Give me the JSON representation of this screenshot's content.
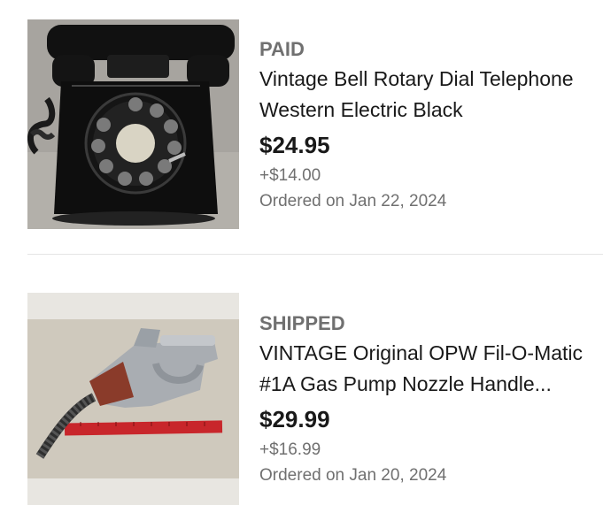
{
  "orders": [
    {
      "status": "PAID",
      "title_line1": "Vintage Bell Rotary Dial Telephone",
      "title_line2": "Western Electric Black",
      "price": "$24.95",
      "shipping": "+$14.00",
      "date": "Ordered on Jan 22, 2024",
      "image": "rotary-telephone-photo"
    },
    {
      "status": "SHIPPED",
      "title_line1": "VINTAGE Original OPW Fil-O-Matic",
      "title_line2": "#1A Gas Pump Nozzle Handle...",
      "price": "$29.99",
      "shipping": "+$16.99",
      "date": "Ordered on Jan 20, 2024",
      "image": "gas-pump-nozzle-photo"
    }
  ],
  "colors": {
    "text_primary": "#191919",
    "text_secondary": "#707070",
    "divider": "#e5e5e5"
  }
}
